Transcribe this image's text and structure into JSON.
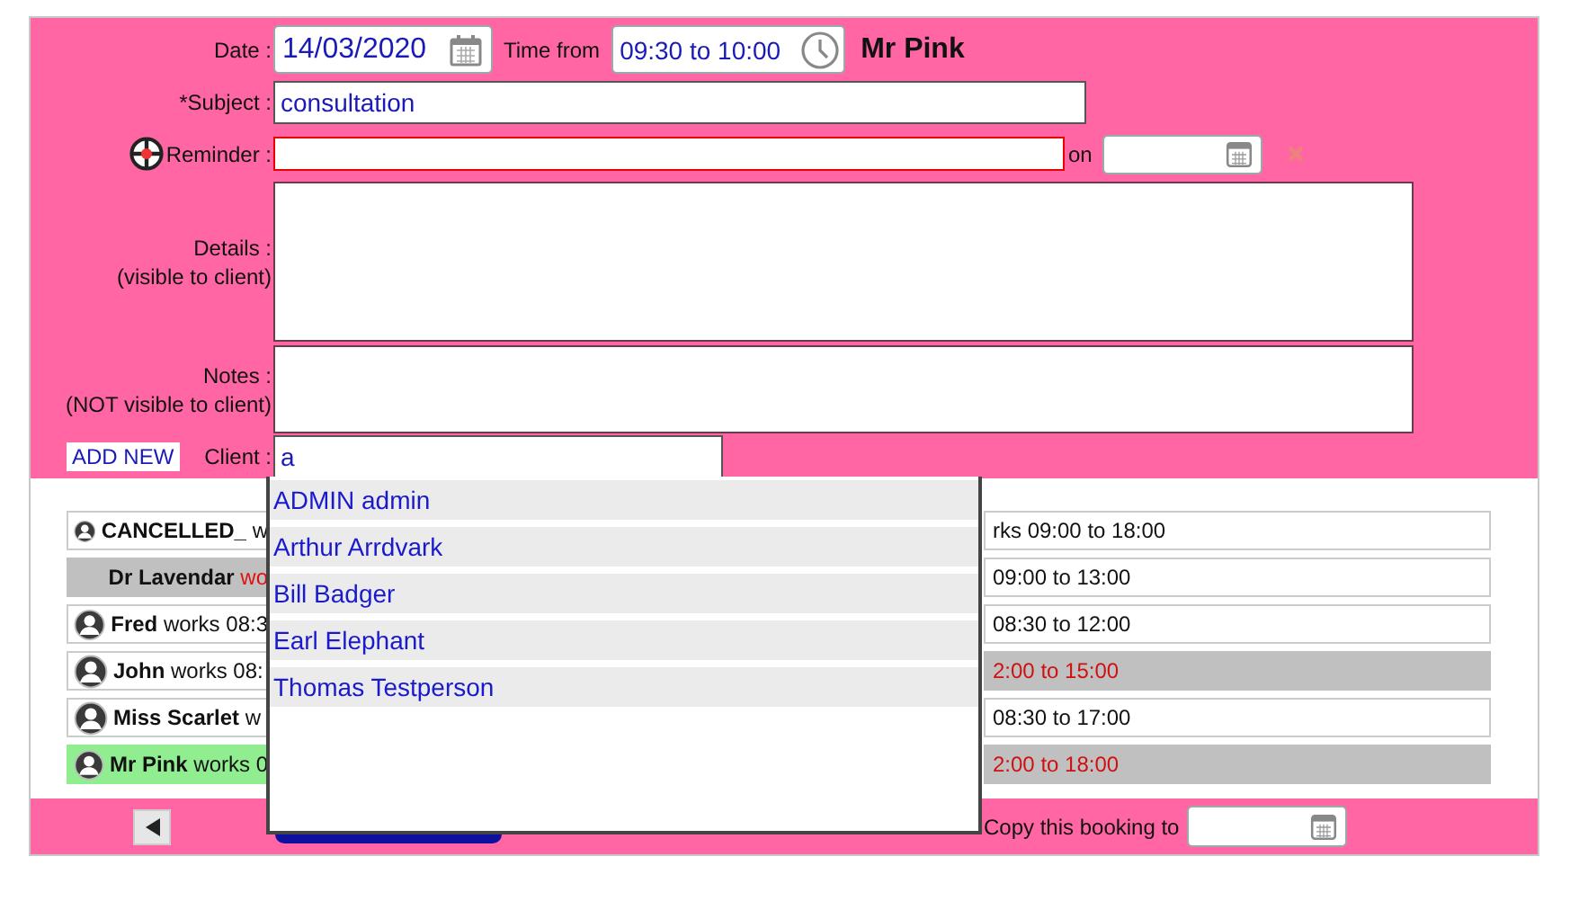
{
  "form": {
    "date_label": "Date :",
    "date": "14/03/2020",
    "time_label": "Time from",
    "time": "09:30 to 10:00",
    "staff_name": "Mr Pink",
    "subject_label": "*Subject :",
    "subject": "consultation",
    "reminder_label": "Reminder :",
    "reminder_invalid": true,
    "reminder_on_label": "on",
    "details_label": "Details :",
    "details_hint": "(visible to client)",
    "notes_label": "Notes :",
    "notes_hint": "(NOT visible to client)",
    "add_new": "ADD NEW",
    "client_label": "Client :",
    "client": "a"
  },
  "client_suggestions": [
    {
      "name": "ADMIN admin"
    },
    {
      "name": "Arthur Arrdvark"
    },
    {
      "name": "Bill Badger"
    },
    {
      "name": "Earl Elephant"
    },
    {
      "name": "Thomas Testperson"
    }
  ],
  "staff": [
    {
      "name": "CANCELLED_",
      "left_rest": "w",
      "right_text": "rks 09:00 to 18:00",
      "unavailable": false,
      "selected": false,
      "busy": false
    },
    {
      "name": "Dr Lavendar",
      "left_rest": "wo",
      "right_text": "09:00 to 13:00",
      "unavailable": true,
      "selected": false,
      "busy": false
    },
    {
      "name": "Fred",
      "left_rest": "works 08:3",
      "right_text": "08:30 to 12:00",
      "unavailable": false,
      "selected": false,
      "busy": false
    },
    {
      "name": "John",
      "left_rest": "works 08:",
      "right_text": "2:00 to 15:00",
      "unavailable": false,
      "selected": false,
      "busy": true
    },
    {
      "name": "Miss Scarlet",
      "left_rest": "w",
      "right_text": "08:30 to 17:00",
      "unavailable": false,
      "selected": false,
      "busy": false
    },
    {
      "name": "Mr Pink",
      "left_rest": "works 0",
      "right_text": "2:00 to 18:00",
      "unavailable": false,
      "selected": true,
      "busy": true
    }
  ],
  "footer": {
    "copy_label": "Copy this booking to"
  }
}
